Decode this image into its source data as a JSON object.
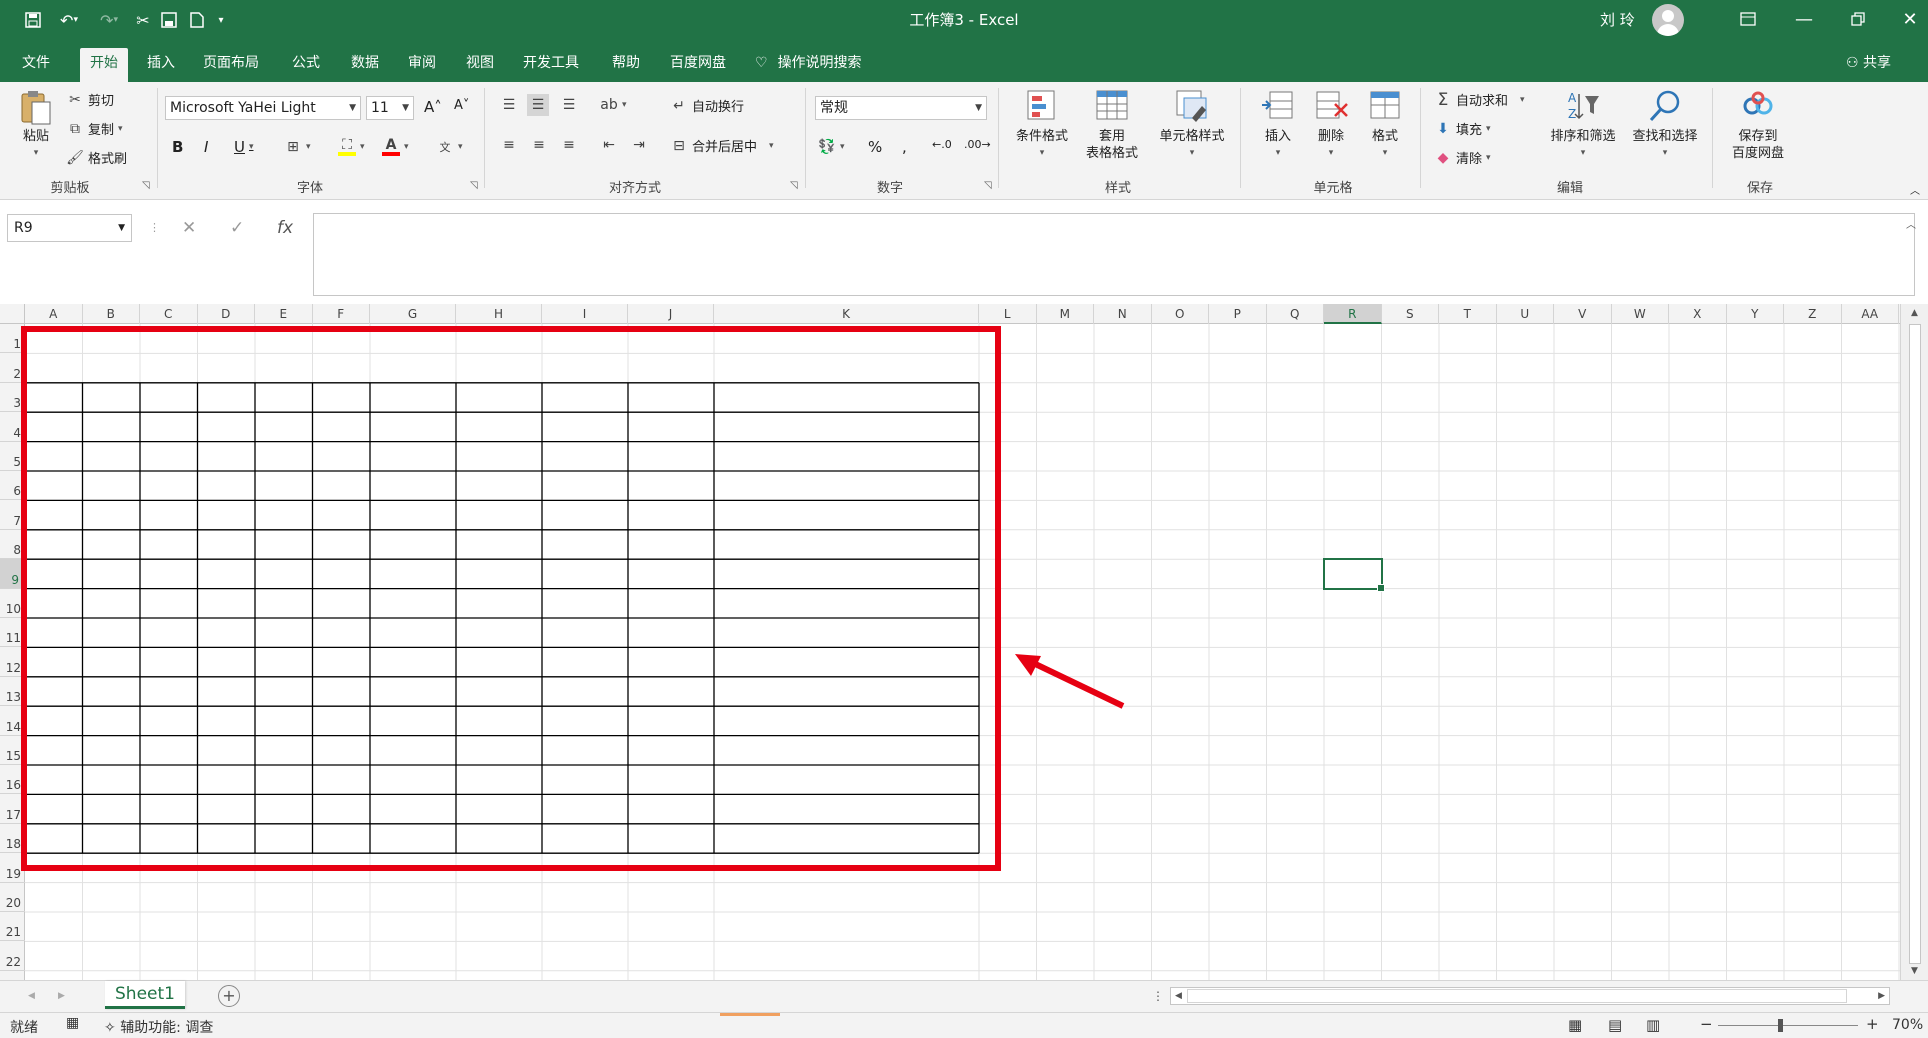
{
  "window": {
    "title": "工作簿3  -  Excel",
    "user": "刘 玲",
    "theme_color": "#217346"
  },
  "ribbon_tabs": [
    "文件",
    "开始",
    "插入",
    "页面布局",
    "公式",
    "数据",
    "审阅",
    "视图",
    "开发工具",
    "帮助",
    "百度网盘"
  ],
  "active_tab": "开始",
  "tell_me": "操作说明搜索",
  "share": "共享",
  "clipboard": {
    "paste": "粘贴",
    "cut": "剪切",
    "copy": "复制",
    "format_painter": "格式刷",
    "label": "剪贴板"
  },
  "font": {
    "name": "Microsoft YaHei Light",
    "size": "11",
    "label": "字体"
  },
  "alignment": {
    "wrap": "自动换行",
    "merge": "合并后居中",
    "label": "对齐方式"
  },
  "number": {
    "format": "常规",
    "label": "数字"
  },
  "styles": {
    "conditional": "条件格式",
    "table_1": "套用",
    "table_2": "表格格式",
    "cell_styles": "单元格样式",
    "label": "样式"
  },
  "cells": {
    "insert": "插入",
    "delete": "删除",
    "format": "格式",
    "label": "单元格"
  },
  "editing": {
    "autosum": "自动求和",
    "fill": "填充",
    "clear": "清除",
    "sort": "排序和筛选",
    "find": "查找和选择",
    "label": "编辑"
  },
  "save": {
    "btn_1": "保存到",
    "btn_2": "百度网盘",
    "label": "保存"
  },
  "formula_bar": {
    "name_box": "R9",
    "formula": ""
  },
  "grid": {
    "columns": [
      "A",
      "B",
      "C",
      "D",
      "E",
      "F",
      "G",
      "H",
      "I",
      "J",
      "K",
      "L",
      "M",
      "N",
      "O",
      "P",
      "Q",
      "R",
      "S",
      "T",
      "U",
      "V",
      "W",
      "X",
      "Y",
      "Z",
      "AA"
    ],
    "rows": [
      "1",
      "2",
      "3",
      "4",
      "5",
      "6",
      "7",
      "8",
      "9",
      "10",
      "11",
      "12",
      "13",
      "14",
      "15",
      "16",
      "17",
      "18",
      "19",
      "20",
      "21",
      "22"
    ],
    "selected_cell": "R9",
    "bordered_range": "A3:K18",
    "highlight_range": "A1:L19",
    "highlight_color": "#e60012"
  },
  "sheets": [
    "Sheet1"
  ],
  "status": {
    "ready": "就绪",
    "accessibility": "辅助功能: 调查",
    "zoom": "70%"
  }
}
